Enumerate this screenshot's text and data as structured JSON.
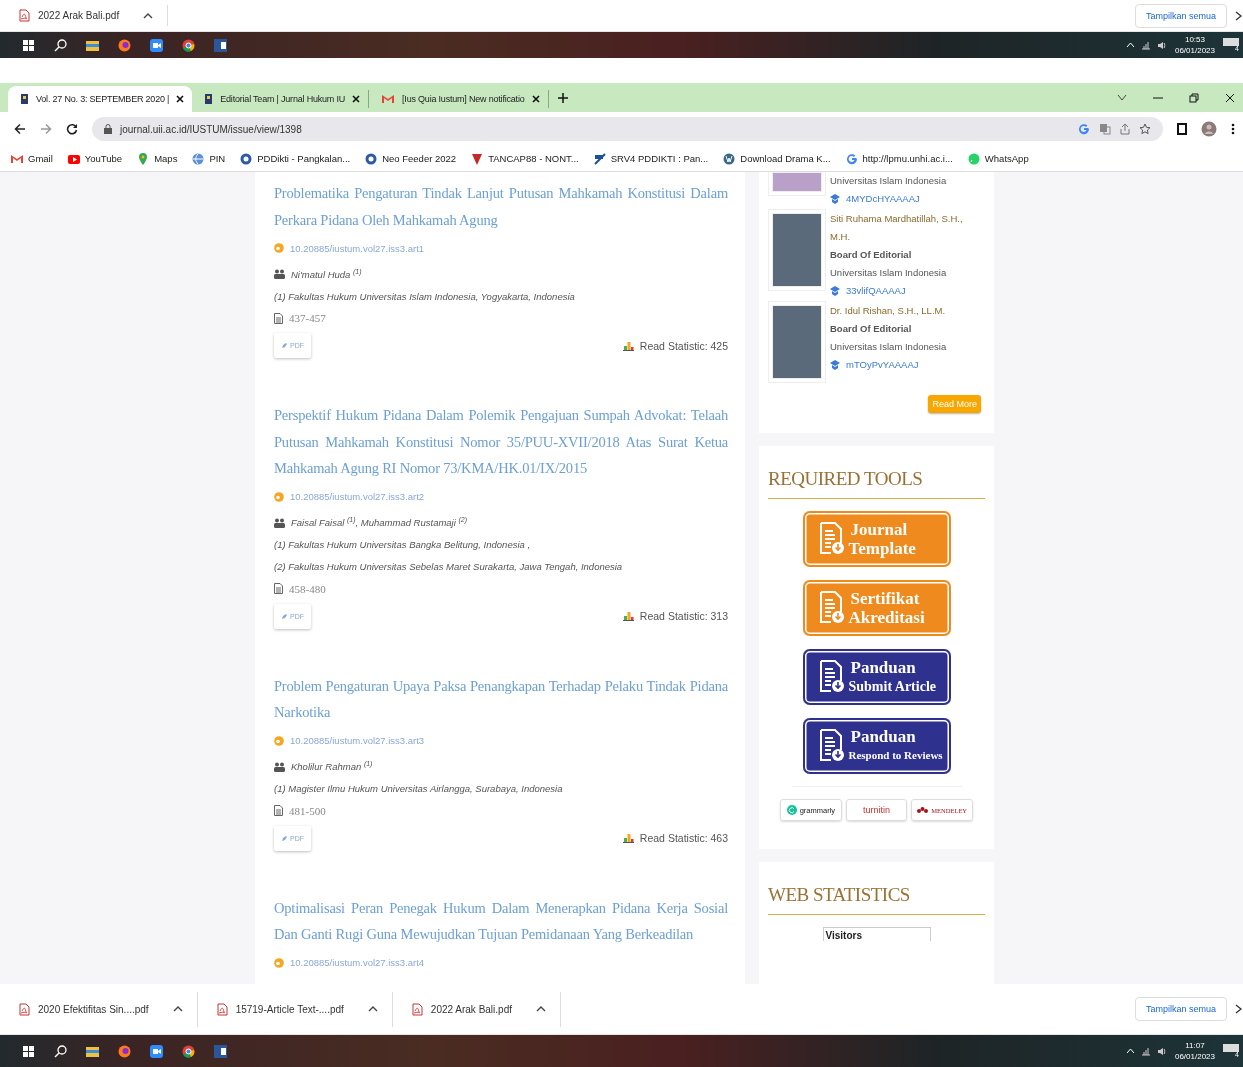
{
  "downloads_top": {
    "files": [
      "2022 Arak Bali.pdf"
    ],
    "show_all": "Tampilkan semua"
  },
  "taskbar_top": {
    "time": "10:53",
    "date": "06/01/2023",
    "notification_count": "4"
  },
  "browser": {
    "tabs": [
      {
        "title": "Vol. 27 No. 3: SEPTEMBER 2020 |",
        "kind": "journal",
        "selected": true
      },
      {
        "title": "Editorial Team | Jurnal Hukum IU",
        "kind": "journal",
        "selected": false
      },
      {
        "title": "[Ius Quia Iustum] New notificatio",
        "kind": "gmail",
        "selected": false
      }
    ],
    "url": "journal.uii.ac.id/IUSTUM/issue/view/1398",
    "bookmarks": [
      {
        "label": "Gmail",
        "kind": "gmail"
      },
      {
        "label": "YouTube",
        "kind": "youtube"
      },
      {
        "label": "Maps",
        "kind": "maps"
      },
      {
        "label": "PIN",
        "kind": "globe"
      },
      {
        "label": "PDDikti - Pangkalan...",
        "kind": "seal"
      },
      {
        "label": "Neo Feeder 2022",
        "kind": "seal"
      },
      {
        "label": "TANCAP88 - NONT...",
        "kind": "tancap"
      },
      {
        "label": "SRV4 PDDIKTI : Pan...",
        "kind": "srv"
      },
      {
        "label": "Download Drama K...",
        "kind": "wordpress"
      },
      {
        "label": "http://lpmu.unhi.ac.i...",
        "kind": "google"
      },
      {
        "label": "WhatsApp",
        "kind": "whatsapp"
      }
    ]
  },
  "articles": [
    {
      "title": "Problematika Pengaturan Tindak Lanjut Putusan Mahkamah Konstitusi Dalam Perkara Pidana Oleh Mahkamah Agung",
      "doi": "10.20885/iustum.vol27.iss3.art1",
      "authors": "Ni'matul Huda $^{(1)}$",
      "affiliations": [
        "(1) Fakultas Hukum Universitas Islam Indonesia, Yogyakarta, Indonesia"
      ],
      "pages": "437-457",
      "pdf": "PDF",
      "statistic": "Read Statistic: 425"
    },
    {
      "title": "Perspektif Hukum Pidana Dalam Polemik Pengajuan Sumpah Advokat: Telaah Putusan Mahkamah Konstitusi Nomor 35/PUU-XVII/2018 Atas Surat Ketua Mahkamah Agung RI Nomor 73/KMA/HK.01/IX/2015",
      "doi": "10.20885/iustum.vol27.iss3.art2",
      "authors": "Faisal Faisal $^{(1)}$, Muhammad Rustamaji $^{(2)}$",
      "affiliations": [
        "(1) Fakultas Hukum Universitas Bangka Belitung, Indonesia ,",
        "(2) Fakultas Hukum Universitas Sebelas Maret Surakarta, Jawa Tengah, Indonesia"
      ],
      "pages": "458-480",
      "pdf": "PDF",
      "statistic": "Read Statistic: 313"
    },
    {
      "title": "Problem Pengaturan Upaya Paksa Penangkapan Terhadap Pelaku Tindak Pidana Narkotika",
      "doi": "10.20885/iustum.vol27.iss3.art3",
      "authors": "Kholilur Rahman $^{(1)}$",
      "affiliations": [
        "(1) Magister Ilmu Hukum Universitas Airlangga, Surabaya, Indonesia"
      ],
      "pages": "481-500",
      "pdf": "PDF",
      "statistic": "Read Statistic: 463"
    },
    {
      "title": "Optimalisasi Peran Penegak Hukum Dalam Menerapkan Pidana Kerja Sosial Dan Ganti Rugi Guna Mewujudkan Tujuan Pemidanaan Yang Berkeadilan",
      "doi": "10.20885/iustum.vol27.iss3.art4"
    }
  ],
  "sidebar": {
    "editorial_team": {
      "members": [
        {
          "affiliation": "Universitas Islam Indonesia",
          "scholar_id": "4MYDcHYAAAAJ"
        },
        {
          "name": "Siti Ruhama Mardhatillah, S.H., M.H.",
          "role": "Board Of Editorial",
          "affiliation": "Universitas Islam Indonesia",
          "scholar_id": "33vlifQAAAAJ"
        },
        {
          "name": "Dr. Idul Rishan, S.H., LL.M.",
          "role": "Board Of Editorial",
          "affiliation": "Universitas Islam Indonesia",
          "scholar_id": "mTOyPvYAAAAJ"
        }
      ],
      "read_more": "Read More"
    },
    "required_tools": {
      "title": "REQUIRED TOOLS",
      "buttons": [
        {
          "line1": "Journal",
          "line2": "Template",
          "color": "#ef8a1e"
        },
        {
          "line1": "Sertifikat",
          "line2": "Akreditasi",
          "color": "#ef8a1e"
        },
        {
          "line1": "Panduan",
          "line2": "Submit Article",
          "color": "#2f318f"
        },
        {
          "line1": "Panduan",
          "line2": "Respond to Reviews",
          "color": "#2f318f"
        }
      ],
      "partners": [
        {
          "label": "grammarly",
          "kind": "grammarly"
        },
        {
          "label": "turnitin",
          "kind": "turnitin"
        },
        {
          "label": "MENDELEY",
          "kind": "mendeley"
        }
      ]
    },
    "web_statistics": {
      "title": "WEB STATISTICS",
      "visitors_label": "Visitors"
    }
  },
  "downloads_bottom": {
    "files": [
      "2020 Efektifitas Sin....pdf",
      "15719-Article Text-....pdf",
      "2022 Arak Bali.pdf"
    ],
    "show_all": "Tampilkan semua"
  },
  "taskbar_bottom": {
    "time": "11:07",
    "date": "06/01/2023",
    "notification_count": "4"
  }
}
